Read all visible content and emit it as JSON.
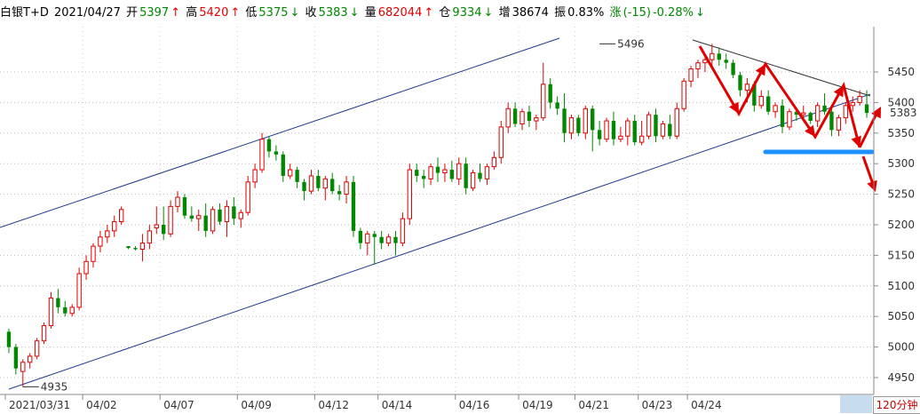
{
  "header": {
    "symbol": "白银T+D",
    "date": "2021/04/27",
    "open_label": "开",
    "open": "5397",
    "high_label": "高",
    "high": "5420",
    "low_label": "低",
    "low": "5375",
    "close_label": "收",
    "close": "5383",
    "vol_label": "量",
    "volume": "682044",
    "oi_label": "仓",
    "oi": "9334",
    "inc_label": "增",
    "increase": "38674",
    "amp_label": "振",
    "amplitude": "0.83%",
    "chg_label": "涨",
    "change": "(-15)",
    "chg_pct": "-0.28%",
    "arrow_up": "↑",
    "arrow_dn": "↓"
  },
  "period_label": "120分钟",
  "colors": {
    "up": "#e00000",
    "down": "#008800",
    "channel": "#1f3a8a",
    "support": "#1e90ff",
    "arrow": "#e00000"
  },
  "chart_data": {
    "type": "candlestick",
    "ylim": [
      4925,
      5520
    ],
    "y_ticks": [
      4950,
      5000,
      5050,
      5100,
      5150,
      5200,
      5250,
      5300,
      5350,
      5400,
      5450
    ],
    "x_tick_labels": [
      {
        "label": "2021/03/31",
        "index": 0
      },
      {
        "label": "04/02",
        "index": 11
      },
      {
        "label": "04/07",
        "index": 22
      },
      {
        "label": "04/09",
        "index": 33
      },
      {
        "label": "04/12",
        "index": 44
      },
      {
        "label": "04/14",
        "index": 53
      },
      {
        "label": "04/16",
        "index": 64
      },
      {
        "label": "04/19",
        "index": 73
      },
      {
        "label": "04/21",
        "index": 81
      },
      {
        "label": "04/23",
        "index": 90
      },
      {
        "label": "04/24",
        "index": 97
      }
    ],
    "annotations": [
      {
        "text": "4935",
        "index": 2,
        "price": 4935
      },
      {
        "text": "5496",
        "index": 84,
        "price": 5496
      }
    ],
    "last_price_label": "5383",
    "candles": [
      [
        5025,
        5030,
        4990,
        5000
      ],
      [
        5000,
        5005,
        4955,
        4965
      ],
      [
        4960,
        4980,
        4935,
        4975
      ],
      [
        4975,
        4990,
        4965,
        4985
      ],
      [
        4985,
        5015,
        4980,
        5010
      ],
      [
        5010,
        5040,
        5005,
        5035
      ],
      [
        5035,
        5090,
        5030,
        5080
      ],
      [
        5080,
        5095,
        5055,
        5065
      ],
      [
        5065,
        5075,
        5050,
        5055
      ],
      [
        5055,
        5070,
        5050,
        5065
      ],
      [
        5065,
        5130,
        5060,
        5120
      ],
      [
        5120,
        5150,
        5110,
        5140
      ],
      [
        5140,
        5170,
        5130,
        5165
      ],
      [
        5165,
        5190,
        5155,
        5180
      ],
      [
        5180,
        5200,
        5170,
        5190
      ],
      [
        5190,
        5215,
        5180,
        5205
      ],
      [
        5205,
        5230,
        5200,
        5225
      ],
      [
        5165,
        5165,
        5160,
        5162
      ],
      [
        5162,
        5165,
        5158,
        5160
      ],
      [
        5160,
        5185,
        5140,
        5170
      ],
      [
        5170,
        5200,
        5160,
        5190
      ],
      [
        5195,
        5230,
        5185,
        5200
      ],
      [
        5200,
        5230,
        5175,
        5185
      ],
      [
        5185,
        5240,
        5180,
        5230
      ],
      [
        5230,
        5255,
        5220,
        5245
      ],
      [
        5245,
        5250,
        5210,
        5215
      ],
      [
        5215,
        5230,
        5205,
        5210
      ],
      [
        5210,
        5225,
        5190,
        5215
      ],
      [
        5215,
        5235,
        5180,
        5190
      ],
      [
        5190,
        5230,
        5185,
        5225
      ],
      [
        5225,
        5235,
        5200,
        5205
      ],
      [
        5205,
        5240,
        5180,
        5230
      ],
      [
        5230,
        5245,
        5200,
        5210
      ],
      [
        5210,
        5225,
        5195,
        5220
      ],
      [
        5220,
        5280,
        5215,
        5270
      ],
      [
        5270,
        5300,
        5260,
        5290
      ],
      [
        5290,
        5350,
        5285,
        5340
      ],
      [
        5340,
        5345,
        5310,
        5320
      ],
      [
        5320,
        5330,
        5305,
        5315
      ],
      [
        5315,
        5320,
        5270,
        5280
      ],
      [
        5280,
        5300,
        5275,
        5290
      ],
      [
        5290,
        5295,
        5260,
        5270
      ],
      [
        5270,
        5275,
        5240,
        5255
      ],
      [
        5255,
        5290,
        5250,
        5280
      ],
      [
        5280,
        5290,
        5255,
        5260
      ],
      [
        5260,
        5280,
        5240,
        5275
      ],
      [
        5275,
        5285,
        5250,
        5255
      ],
      [
        5255,
        5265,
        5240,
        5250
      ],
      [
        5250,
        5280,
        5235,
        5270
      ],
      [
        5270,
        5280,
        5180,
        5190
      ],
      [
        5190,
        5195,
        5160,
        5170
      ],
      [
        5170,
        5190,
        5150,
        5185
      ],
      [
        5185,
        5190,
        5135,
        5180
      ],
      [
        5180,
        5190,
        5160,
        5170
      ],
      [
        5170,
        5185,
        5165,
        5180
      ],
      [
        5180,
        5190,
        5150,
        5170
      ],
      [
        5170,
        5220,
        5165,
        5210
      ],
      [
        5210,
        5300,
        5200,
        5290
      ],
      [
        5290,
        5300,
        5270,
        5280
      ],
      [
        5280,
        5290,
        5260,
        5275
      ],
      [
        5275,
        5300,
        5265,
        5295
      ],
      [
        5295,
        5310,
        5270,
        5285
      ],
      [
        5285,
        5300,
        5270,
        5290
      ],
      [
        5290,
        5305,
        5270,
        5275
      ],
      [
        5275,
        5310,
        5265,
        5300
      ],
      [
        5300,
        5310,
        5250,
        5260
      ],
      [
        5260,
        5290,
        5255,
        5285
      ],
      [
        5285,
        5300,
        5270,
        5275
      ],
      [
        5275,
        5300,
        5265,
        5295
      ],
      [
        5295,
        5320,
        5290,
        5310
      ],
      [
        5310,
        5370,
        5300,
        5360
      ],
      [
        5360,
        5400,
        5350,
        5390
      ],
      [
        5390,
        5400,
        5360,
        5365
      ],
      [
        5365,
        5390,
        5355,
        5385
      ],
      [
        5385,
        5395,
        5360,
        5370
      ],
      [
        5370,
        5380,
        5355,
        5375
      ],
      [
        5375,
        5465,
        5370,
        5430
      ],
      [
        5430,
        5440,
        5390,
        5400
      ],
      [
        5400,
        5410,
        5380,
        5390
      ],
      [
        5390,
        5415,
        5335,
        5350
      ],
      [
        5350,
        5380,
        5340,
        5375
      ],
      [
        5375,
        5380,
        5345,
        5350
      ],
      [
        5350,
        5395,
        5340,
        5390
      ],
      [
        5390,
        5395,
        5320,
        5355
      ],
      [
        5355,
        5370,
        5330,
        5340
      ],
      [
        5340,
        5375,
        5335,
        5370
      ],
      [
        5370,
        5385,
        5330,
        5340
      ],
      [
        5340,
        5360,
        5335,
        5345
      ],
      [
        5345,
        5375,
        5330,
        5370
      ],
      [
        5370,
        5380,
        5330,
        5335
      ],
      [
        5335,
        5370,
        5330,
        5345
      ],
      [
        5345,
        5385,
        5340,
        5380
      ],
      [
        5380,
        5390,
        5335,
        5345
      ],
      [
        5345,
        5370,
        5340,
        5365
      ],
      [
        5365,
        5380,
        5340,
        5345
      ],
      [
        5345,
        5400,
        5340,
        5390
      ],
      [
        5390,
        5440,
        5385,
        5435
      ],
      [
        5435,
        5460,
        5425,
        5455
      ],
      [
        5455,
        5470,
        5440,
        5465
      ],
      [
        5465,
        5475,
        5450,
        5470
      ],
      [
        5470,
        5496,
        5460,
        5480
      ],
      [
        5480,
        5490,
        5460,
        5470
      ],
      [
        5470,
        5480,
        5455,
        5465
      ],
      [
        5465,
        5470,
        5440,
        5445
      ],
      [
        5445,
        5450,
        5410,
        5420
      ],
      [
        5420,
        5440,
        5400,
        5430
      ],
      [
        5430,
        5435,
        5385,
        5395
      ],
      [
        5395,
        5420,
        5390,
        5410
      ],
      [
        5410,
        5420,
        5380,
        5385
      ],
      [
        5385,
        5400,
        5375,
        5395
      ],
      [
        5395,
        5405,
        5350,
        5360
      ],
      [
        5360,
        5390,
        5355,
        5385
      ],
      [
        5385,
        5390,
        5370,
        5380
      ],
      [
        5380,
        5395,
        5375,
        5383
      ],
      [
        5383,
        5385,
        5365,
        5370
      ],
      [
        5370,
        5400,
        5360,
        5395
      ],
      [
        5395,
        5415,
        5380,
        5385
      ],
      [
        5385,
        5395,
        5345,
        5355
      ],
      [
        5355,
        5380,
        5345,
        5375
      ],
      [
        5375,
        5400,
        5365,
        5395
      ],
      [
        5395,
        5410,
        5385,
        5400
      ],
      [
        5400,
        5420,
        5395,
        5410
      ],
      [
        5397,
        5420,
        5375,
        5383
      ]
    ]
  }
}
